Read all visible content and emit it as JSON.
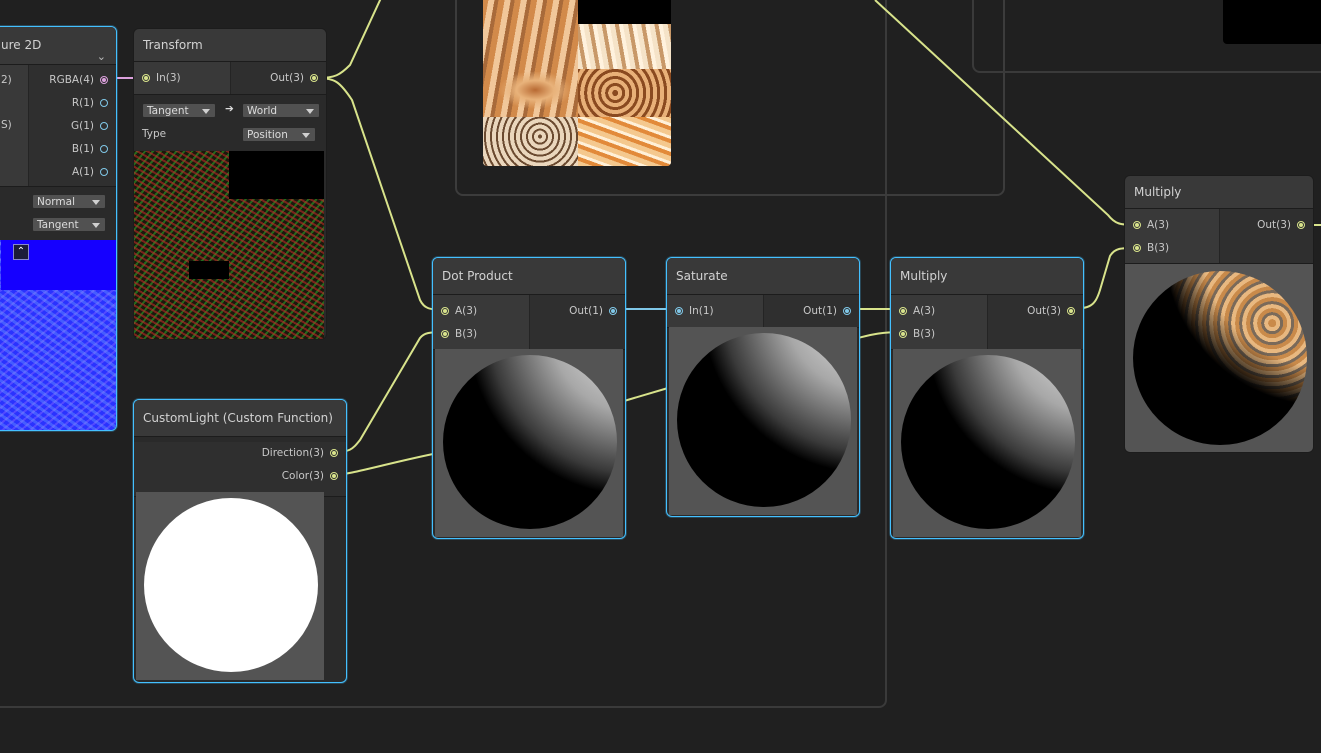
{
  "sample_texture": {
    "title": "ure 2D",
    "inputs": [
      "2)",
      "S)"
    ],
    "outputs": [
      "RGBA(4)",
      "R(1)",
      "G(1)",
      "B(1)",
      "A(1)"
    ],
    "space_value": "Normal",
    "type_value": "Tangent"
  },
  "transform": {
    "title": "Transform",
    "input": "In(3)",
    "output": "Out(3)",
    "from_space": "Tangent",
    "arrow": "➔",
    "to_space": "World",
    "type_label": "Type",
    "type_value": "Position"
  },
  "custom_light": {
    "title": "CustomLight (Custom Function)",
    "outputs": [
      "Direction(3)",
      "Color(3)"
    ]
  },
  "dot_product": {
    "title": "Dot Product",
    "inputs": [
      "A(3)",
      "B(3)"
    ],
    "output": "Out(1)"
  },
  "saturate": {
    "title": "Saturate",
    "input": "In(1)",
    "output": "Out(1)"
  },
  "multiply_1": {
    "title": "Multiply",
    "inputs": [
      "A(3)",
      "B(3)"
    ],
    "output": "Out(3)"
  },
  "multiply_2": {
    "title": "Multiply",
    "inputs": [
      "A(3)",
      "B(3)"
    ],
    "output": "Out(3)"
  },
  "colors": {
    "background": "#202020",
    "wire_vector": "#d8e38b",
    "wire_float": "#80c8e8",
    "selection": "#44c0ff"
  }
}
